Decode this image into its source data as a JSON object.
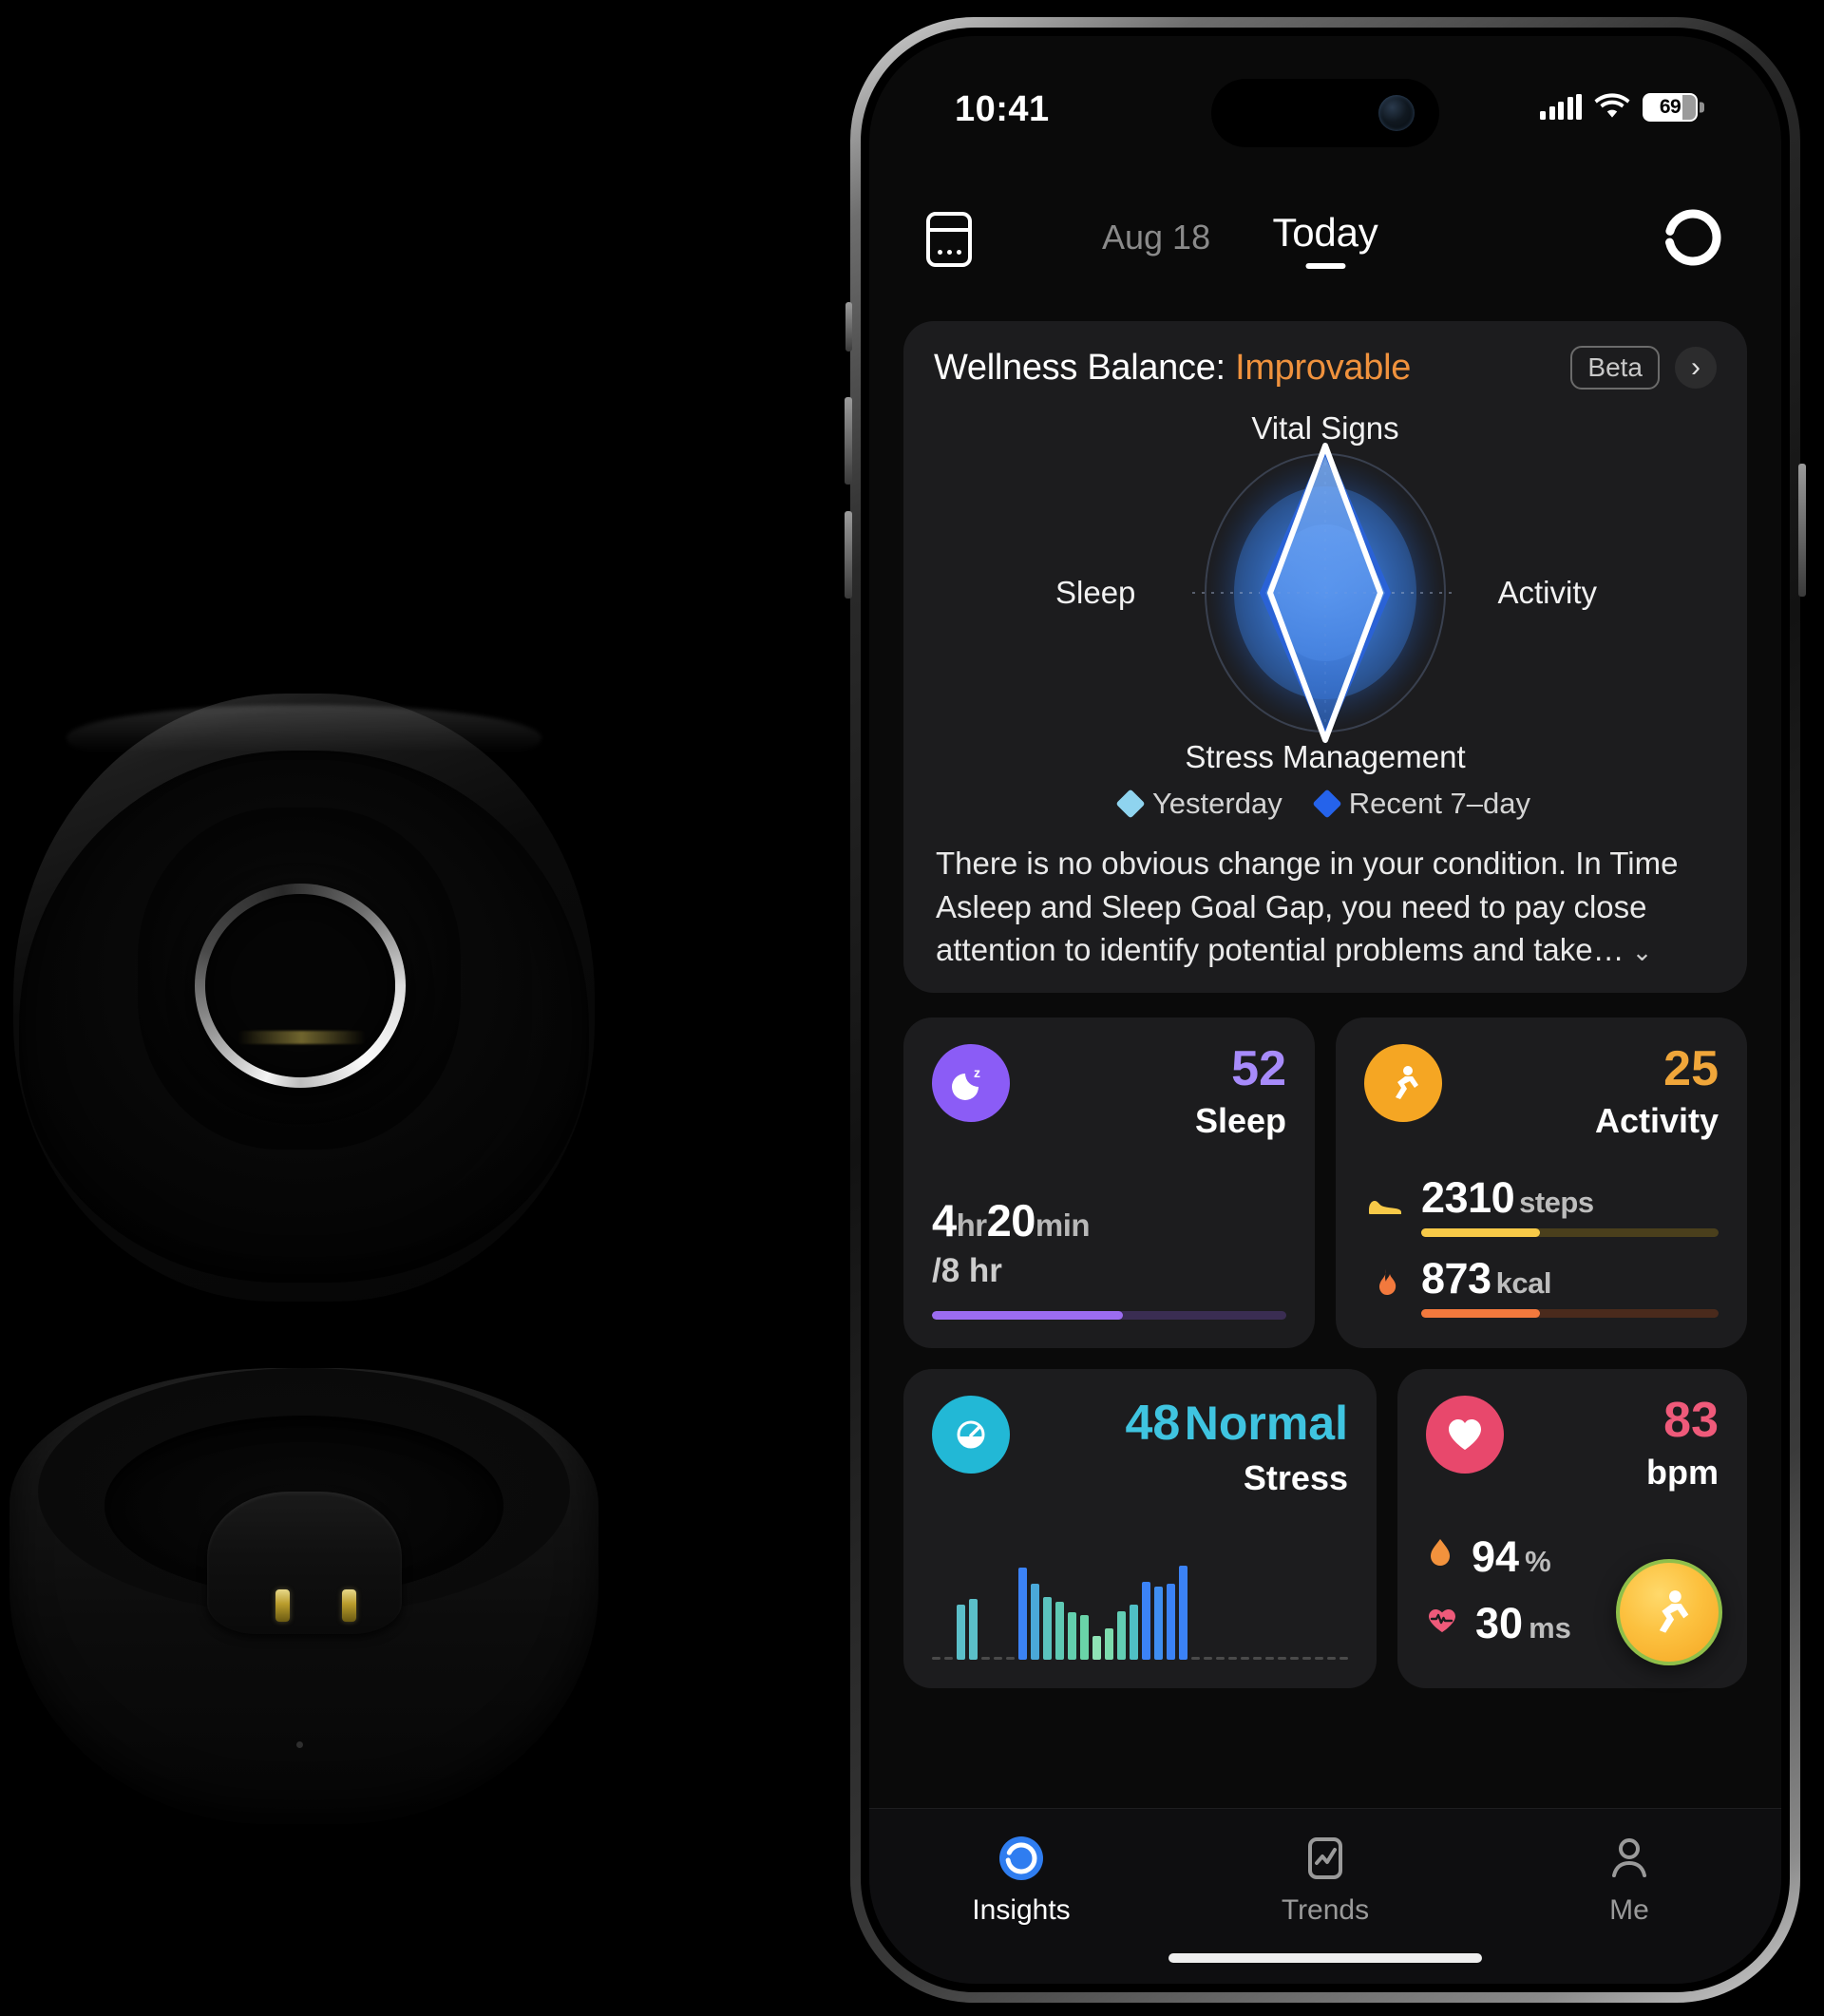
{
  "statusbar": {
    "time": "10:41",
    "battery_pct": "69",
    "signal_icon": "cellular-bars-icon",
    "wifi_icon": "wifi-icon",
    "battery_icon": "battery-icon"
  },
  "navbar": {
    "calendar_icon": "calendar-icon",
    "date": "Aug 18",
    "title": "Today",
    "sync_icon": "sync-refresh-icon"
  },
  "wellness": {
    "title_prefix": "Wellness Balance: ",
    "status": "Improvable",
    "badge": "Beta",
    "chevron": "›",
    "description": "There is no obvious change in your condition. In Time Asleep and Sleep Goal Gap, you need to pay close attention to identify potential problems and take…",
    "expand_chevron": "⌄",
    "legend": [
      {
        "label": "Yesterday",
        "color": "#8fd4ef"
      },
      {
        "label": "Recent 7–day",
        "color": "#2563eb"
      }
    ],
    "chart_data": {
      "type": "radar",
      "title": "Wellness Balance",
      "axes": [
        "Vital Signs",
        "Activity",
        "Stress Management",
        "Sleep"
      ],
      "axis_order": [
        "top",
        "right",
        "bottom",
        "left"
      ],
      "rmax": 100,
      "grid": true,
      "legend_position": "bottom",
      "series": [
        {
          "name": "Yesterday",
          "color": "#8fd4ef",
          "values": [
            96,
            30,
            96,
            30
          ]
        },
        {
          "name": "Recent 7–day",
          "color": "#2563eb",
          "values": [
            88,
            26,
            88,
            26
          ]
        }
      ]
    }
  },
  "metrics": {
    "sleep": {
      "icon": "moon-sleep-icon",
      "icon_color": "#8b5cf6",
      "score": "52",
      "score_color": "#a78bfa",
      "label": "Sleep",
      "hours": "4",
      "hours_unit": "hr",
      "minutes": "20",
      "minutes_unit": "min",
      "goal": "/8 hr",
      "progress_pct": 54,
      "bar_color": "#9b6cf0",
      "bar_track": "#3a2d52"
    },
    "activity": {
      "icon": "running-person-icon",
      "icon_color": "#f5a623",
      "score": "25",
      "score_color": "#f0a63a",
      "label": "Activity",
      "rows": [
        {
          "icon": "sneaker-icon",
          "glyph": "👟",
          "value": "2310",
          "unit": "steps",
          "progress_pct": 40,
          "bar_color": "#f7c948",
          "bar_track": "#4a3f1c"
        },
        {
          "icon": "flame-icon",
          "glyph": "🔥",
          "value": "873",
          "unit": "kcal",
          "progress_pct": 40,
          "bar_color": "#f2793d",
          "bar_track": "#4a2a1c"
        }
      ]
    },
    "stress": {
      "icon": "stress-gauge-icon",
      "icon_color": "#22b8d6",
      "score": "48",
      "score_color": "#3fc4e0",
      "state": "Normal",
      "label": "Stress",
      "chart_data": {
        "type": "bar",
        "title": "Stress trend",
        "values": [
          0,
          0,
          52,
          58,
          0,
          0,
          0,
          88,
          72,
          60,
          55,
          45,
          42,
          22,
          30,
          46,
          52,
          74,
          70,
          72,
          90,
          0,
          0,
          0,
          0,
          0,
          0,
          0,
          0,
          0,
          0,
          0,
          0,
          0
        ],
        "colors": [
          "#5bbfc9",
          "#5bbfc9",
          "#5bbfc9",
          "#5bbfc9",
          "#3b82f6",
          "#3b82f6",
          "#3b82f6",
          "#3b82f6",
          "#4aa8d8",
          "#5bc2be",
          "#5ec9b4",
          "#63cfae",
          "#6ad3a8",
          "#8fe3b6",
          "#7ddcae",
          "#62cdb4",
          "#4fbfc6",
          "#3b82f6",
          "#3f8ef0",
          "#3b82f6",
          "#3b82f6"
        ],
        "ylim": [
          0,
          100
        ],
        "grid": false
      }
    },
    "heart": {
      "icon": "heart-icon",
      "icon_color": "#e8486c",
      "score": "83",
      "score_color": "#ef5a7a",
      "label": "bpm",
      "rows": [
        {
          "icon": "blood-oxygen-drop-icon",
          "glyph": "💧",
          "value": "94",
          "unit": "%"
        },
        {
          "icon": "hrv-heartbeat-icon",
          "glyph": "♥",
          "value": "30",
          "unit": "ms"
        }
      ],
      "fab_icon": "workout-run-icon"
    }
  },
  "tabbar": {
    "tabs": [
      {
        "id": "insights",
        "label": "Insights",
        "icon": "insights-ring-icon",
        "active": true
      },
      {
        "id": "trends",
        "label": "Trends",
        "icon": "trends-chart-icon",
        "active": false
      },
      {
        "id": "me",
        "label": "Me",
        "icon": "person-icon",
        "active": false
      }
    ]
  },
  "product": {
    "name": "smart-ring-charging-case",
    "parts": [
      "case-lid",
      "case-base",
      "smart-ring",
      "charging-pins"
    ]
  }
}
